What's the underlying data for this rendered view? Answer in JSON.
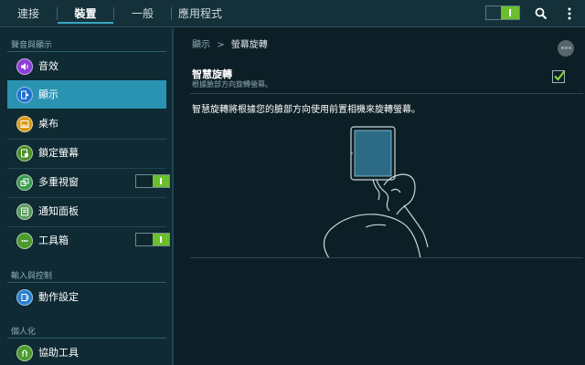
{
  "tabs": [
    {
      "label": "連接",
      "active": false
    },
    {
      "label": "裝置",
      "active": true
    },
    {
      "label": "一般",
      "active": false
    },
    {
      "label": "應用程式",
      "active": false
    }
  ],
  "top_actions": {
    "master_switch": "on",
    "search_icon": "search-icon",
    "menu_icon": "overflow-menu-icon"
  },
  "sidebar": {
    "sections": [
      {
        "header": "聲音與顯示"
      },
      {
        "header": "輸入與控制"
      },
      {
        "header": "個人化"
      }
    ],
    "items": [
      {
        "label": "音效",
        "icon": "speaker-icon",
        "icon_color": "#8c3fd6"
      },
      {
        "label": "顯示",
        "icon": "display-icon",
        "icon_color": "#1f6fd0",
        "selected": true
      },
      {
        "label": "桌布",
        "icon": "wallpaper-icon",
        "icon_color": "#d89a1a"
      },
      {
        "label": "鎖定螢幕",
        "icon": "lock-screen-icon",
        "icon_color": "#4a8f2a"
      },
      {
        "label": "多重視窗",
        "icon": "multi-window-icon",
        "icon_color": "#3a9a4e",
        "toggle": "on"
      },
      {
        "label": "通知面板",
        "icon": "notification-panel-icon",
        "icon_color": "#5a9a5e"
      },
      {
        "label": "工具箱",
        "icon": "toolbox-icon",
        "icon_color": "#4a9a2e",
        "toggle": "on"
      },
      {
        "label": "動作設定",
        "icon": "motion-icon",
        "icon_color": "#2a7fd0"
      },
      {
        "label": "協助工具",
        "icon": "accessibility-icon",
        "icon_color": "#4a9a2e"
      }
    ]
  },
  "content": {
    "breadcrumb_parent": "顯示",
    "breadcrumb_sep": ">",
    "breadcrumb_current": "螢幕旋轉",
    "setting": {
      "title": "智慧旋轉",
      "subtitle": "根據臉部方向旋轉螢幕。",
      "checked": true
    },
    "description": "智慧旋轉將根據您的臉部方向使用前置相機來旋轉螢幕。"
  },
  "colors": {
    "accent": "#2a93b2",
    "toggle_on": "#6bbf2e",
    "check": "#8bd33a"
  }
}
